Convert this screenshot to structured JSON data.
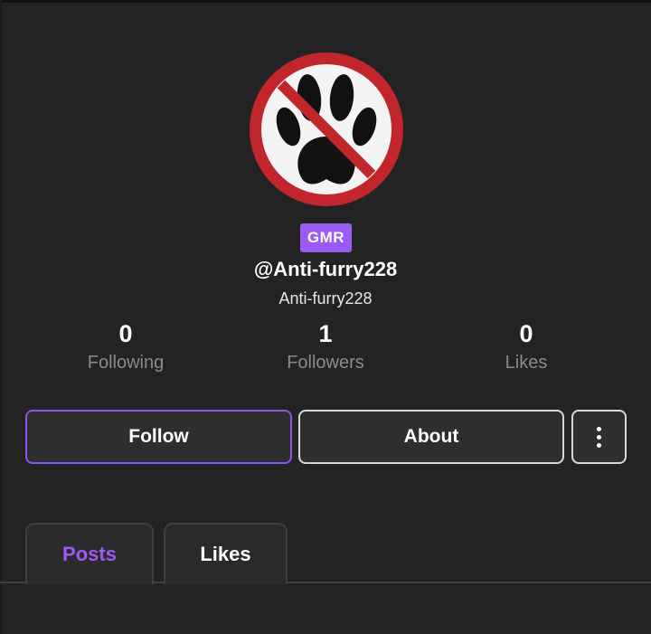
{
  "profile": {
    "badge": "GMR",
    "handle": "@Anti-furry228",
    "display_name": "Anti-furry228",
    "avatar_icon": "no-paw-icon"
  },
  "stats": [
    {
      "value": "0",
      "label": "Following"
    },
    {
      "value": "1",
      "label": "Followers"
    },
    {
      "value": "0",
      "label": "Likes"
    }
  ],
  "actions": {
    "follow_label": "Follow",
    "about_label": "About",
    "more_icon": "vertical-dots-icon"
  },
  "tabs": [
    {
      "label": "Posts",
      "active": true
    },
    {
      "label": "Likes",
      "active": false
    }
  ],
  "colors": {
    "background": "#232323",
    "accent": "#9b59f6",
    "avatar_ring": "#c0262c"
  }
}
